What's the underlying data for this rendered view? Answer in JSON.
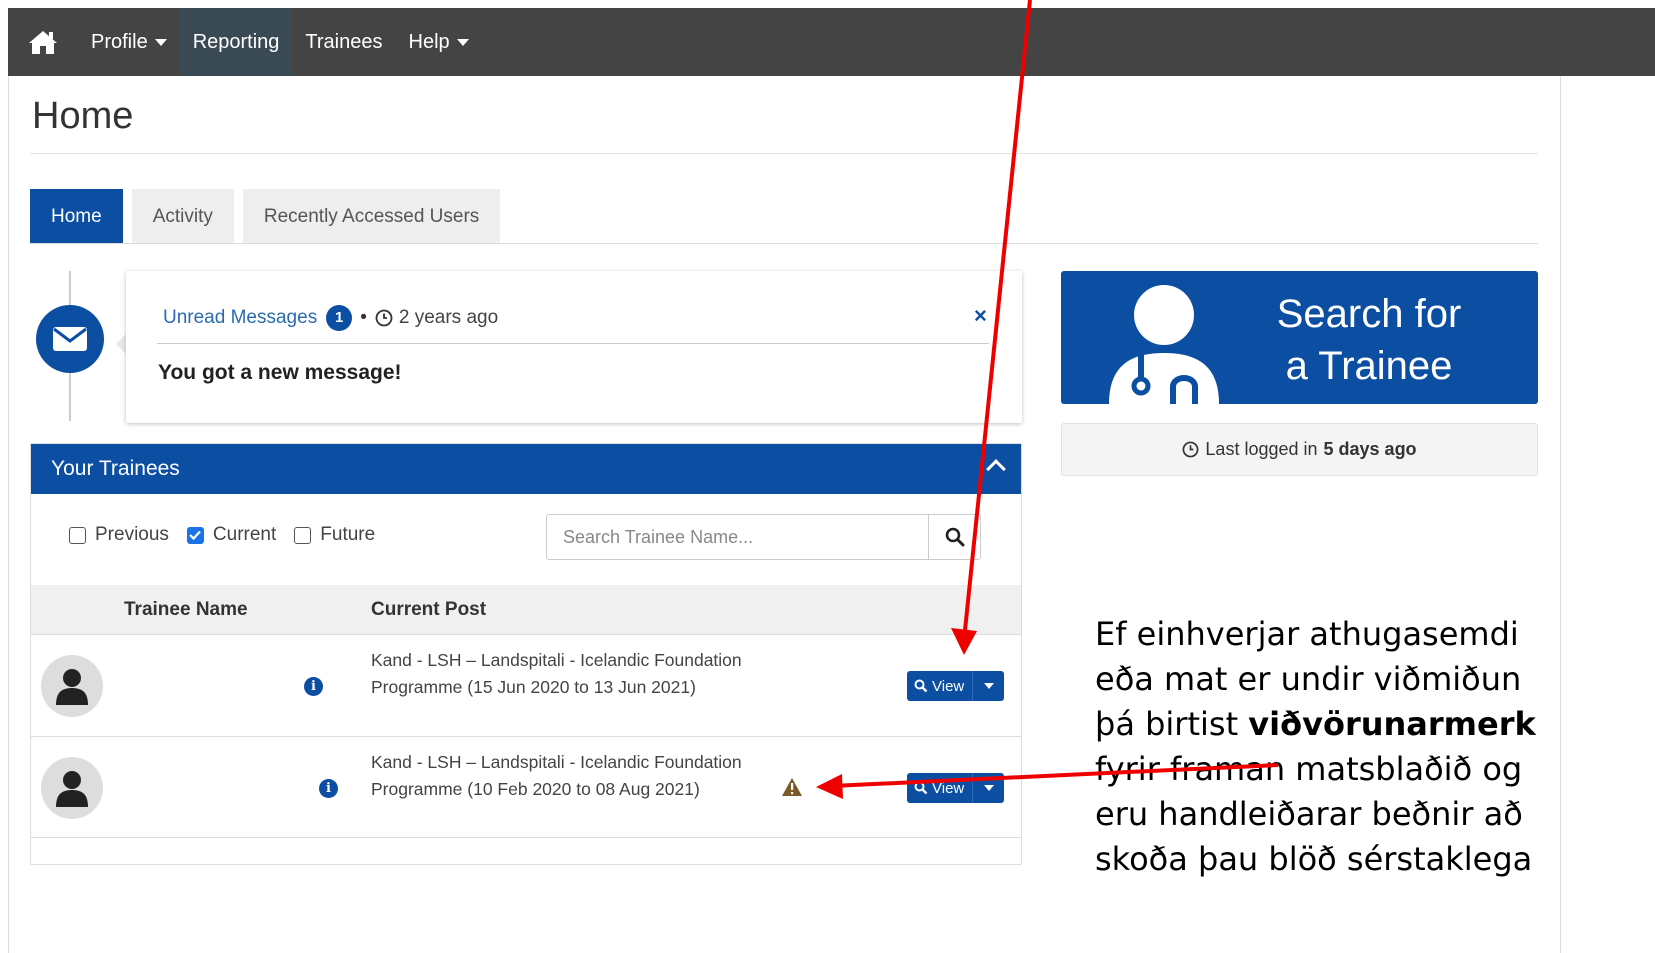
{
  "nav": {
    "items": [
      {
        "label": "Profile",
        "dropdown": true
      },
      {
        "label": "Reporting",
        "active": true
      },
      {
        "label": "Trainees"
      },
      {
        "label": "Help",
        "dropdown": true
      }
    ]
  },
  "page": {
    "title": "Home"
  },
  "tabs": [
    "Home",
    "Activity",
    "Recently Accessed Users"
  ],
  "message": {
    "link": "Unread Messages",
    "count": "1",
    "time": "2 years ago",
    "body": "You got a new message!",
    "close": "×"
  },
  "trainees": {
    "title": "Your Trainees",
    "filters": [
      {
        "label": "Previous",
        "checked": false
      },
      {
        "label": "Current",
        "checked": true
      },
      {
        "label": "Future",
        "checked": false
      }
    ],
    "search_placeholder": "Search Trainee Name...",
    "headers": {
      "name": "Trainee Name",
      "post": "Current Post"
    },
    "rows": [
      {
        "post": "Kand - LSH – Landspitali - Icelandic Foundation Programme (15 Jun 2020 to 13 Jun 2021)",
        "warning": false,
        "view": "View"
      },
      {
        "post": "Kand - LSH – Landspitali - Icelandic Foundation Programme (10 Feb 2020 to 08 Aug 2021)",
        "warning": true,
        "view": "View"
      }
    ]
  },
  "sidebar": {
    "search_card": {
      "line1": "Search for",
      "line2": "a Trainee"
    },
    "login": {
      "prefix": "Last logged in",
      "value": "5 days ago"
    }
  },
  "annotation": {
    "lines": [
      "Ef einhverjar athugasemdi",
      "eða mat er undir viðmiðun",
      "þá birtist ",
      "fyrir framan matsblaðið og",
      "eru handleiðarar beðnir að",
      "skoða þau blöð sérstaklega"
    ],
    "bold": "viðvörunarmerk"
  },
  "colors": {
    "primary": "#0b4ea2",
    "navbar": "#444444",
    "arrow": "#ee0000",
    "warning": "#7a5a2a"
  }
}
